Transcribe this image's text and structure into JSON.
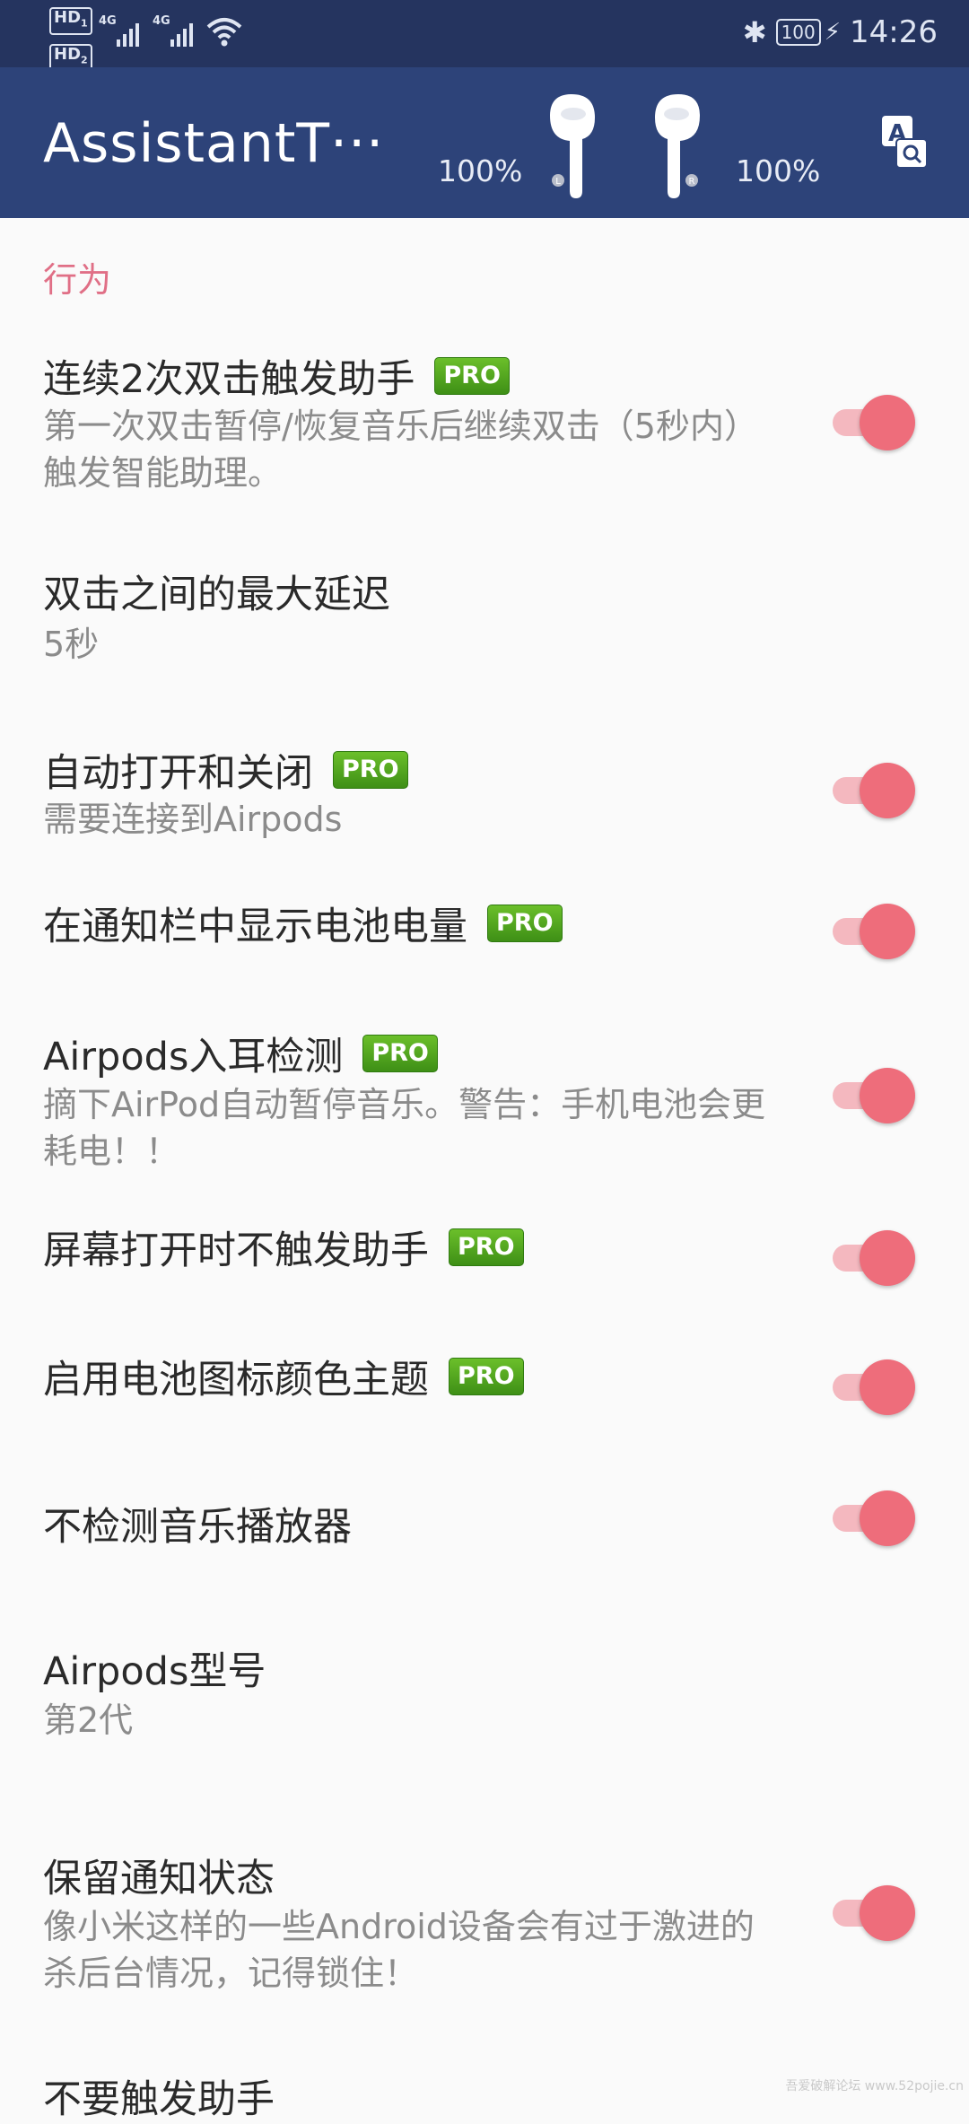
{
  "status_bar": {
    "hd1": "HD",
    "hd1_num": "1",
    "hd2": "HD",
    "hd2_num": "2",
    "signal1_label": "4G",
    "signal2_label": "4G",
    "battery": "100",
    "time": "14:26",
    "icons": [
      "bluetooth-icon",
      "wifi-icon",
      "battery-icon",
      "charging-icon"
    ]
  },
  "app_bar": {
    "title": "AssistantT···",
    "left_percent": "100%",
    "right_percent": "100%",
    "left_pod_label": "L",
    "right_pod_label": "R",
    "translate_icon_letter": "A",
    "colors": {
      "background": "#2d4379",
      "status": "#25345f"
    }
  },
  "section": {
    "label": "行为"
  },
  "items": [
    {
      "title": "连续2次双击触发助手",
      "pro": "PRO",
      "subtitle": "第一次双击暂停/恢复音乐后继续双击（5秒内）触发智能助理。",
      "toggle": true
    },
    {
      "title": "双击之间的最大延迟",
      "subtitle": "5秒"
    },
    {
      "title": "自动打开和关闭",
      "pro": "PRO",
      "subtitle": "需要连接到Airpods",
      "toggle": true
    },
    {
      "title": "在通知栏中显示电池电量",
      "pro": "PRO",
      "toggle": true
    },
    {
      "title": "Airpods入耳检测",
      "pro": "PRO",
      "subtitle": "摘下AirPod自动暂停音乐。警告：手机电池会更耗电！！",
      "toggle": true
    },
    {
      "title": "屏幕打开时不触发助手",
      "pro": "PRO",
      "toggle": true
    },
    {
      "title": "启用电池图标颜色主题",
      "pro": "PRO",
      "toggle": true
    },
    {
      "title": "不检测音乐播放器",
      "toggle": true
    },
    {
      "title": "Airpods型号",
      "subtitle": "第2代"
    },
    {
      "title": "保留通知状态",
      "subtitle": "像小米这样的一些Android设备会有过于激进的杀后台情况，记得锁住！",
      "toggle": true
    },
    {
      "title": "不要触发助手"
    }
  ],
  "accent_color": "#ee6d7b",
  "watermark": "吾爱破解论坛 www.52pojie.cn"
}
